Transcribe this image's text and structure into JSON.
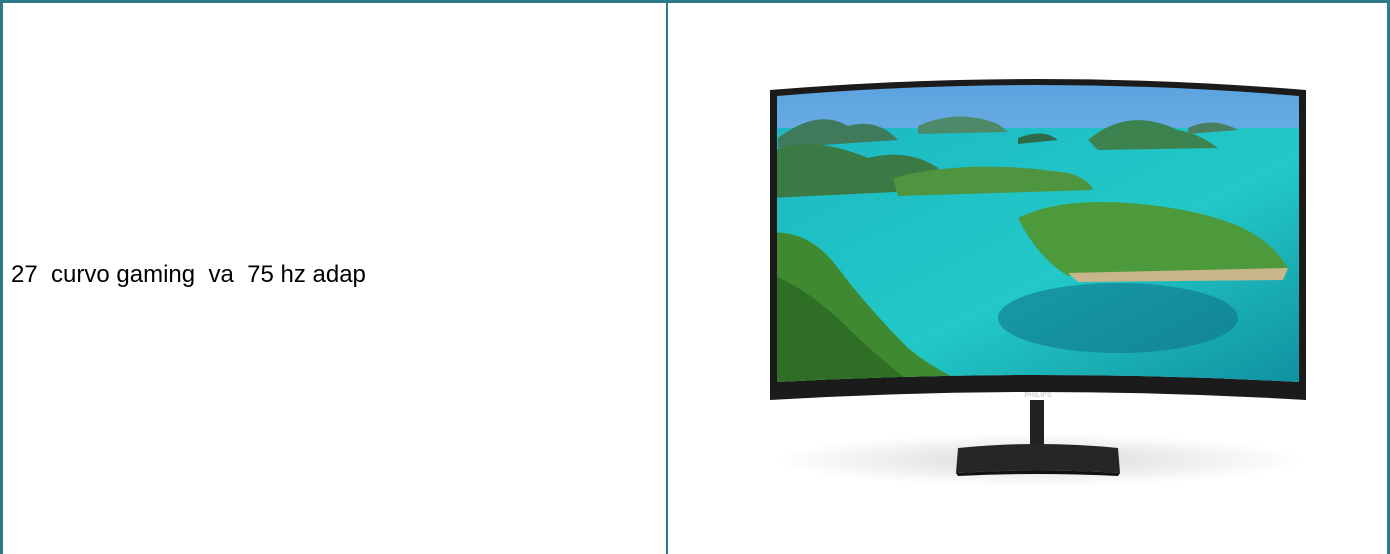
{
  "product": {
    "title": "27  curvo gaming  va  75 hz adap",
    "image": {
      "icon": "curved-monitor-image",
      "brand": "PHILIPS",
      "screen_scene": "turquoise-sea-islands"
    }
  },
  "colors": {
    "border": "#2d7a8a",
    "bezel": "#1b1b1b",
    "sea": "#1fc4c6"
  }
}
